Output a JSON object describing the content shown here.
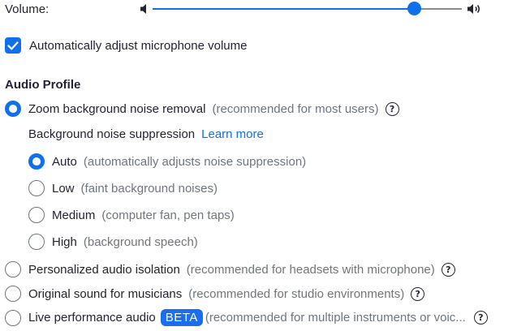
{
  "volume": {
    "label": "Volume:",
    "level": 0.85
  },
  "auto_adjust": {
    "label": "Automatically adjust microphone volume",
    "checked": true
  },
  "audio_profile": {
    "title": "Audio Profile",
    "options": [
      {
        "label": "Zoom background noise removal",
        "hint": "(recommended for most users)",
        "selected": true
      },
      {
        "label": "Personalized audio isolation",
        "hint": "(recommended for headsets with microphone)",
        "selected": false
      },
      {
        "label": "Original sound for musicians",
        "hint": "(recommended for studio environments)",
        "selected": false
      },
      {
        "label": "Live performance audio",
        "badge": "BETA",
        "hint": "(recommended for multiple instruments or voic...",
        "selected": false
      }
    ]
  },
  "noise_suppression": {
    "label": "Background noise suppression",
    "learn_more": "Learn more",
    "levels": [
      {
        "label": "Auto",
        "hint": "(automatically adjusts noise suppression)",
        "selected": true
      },
      {
        "label": "Low",
        "hint": "(faint background noises)",
        "selected": false
      },
      {
        "label": "Medium",
        "hint": "(computer fan, pen taps)",
        "selected": false
      },
      {
        "label": "High",
        "hint": "(background speech)",
        "selected": false
      }
    ]
  },
  "help_glyph": "?",
  "colors": {
    "accent": "#0e71eb",
    "text": "#232333",
    "muted": "#6e7680"
  },
  "icons": [
    "speaker-low-icon",
    "speaker-high-icon",
    "checkmark-icon",
    "help-icon"
  ]
}
